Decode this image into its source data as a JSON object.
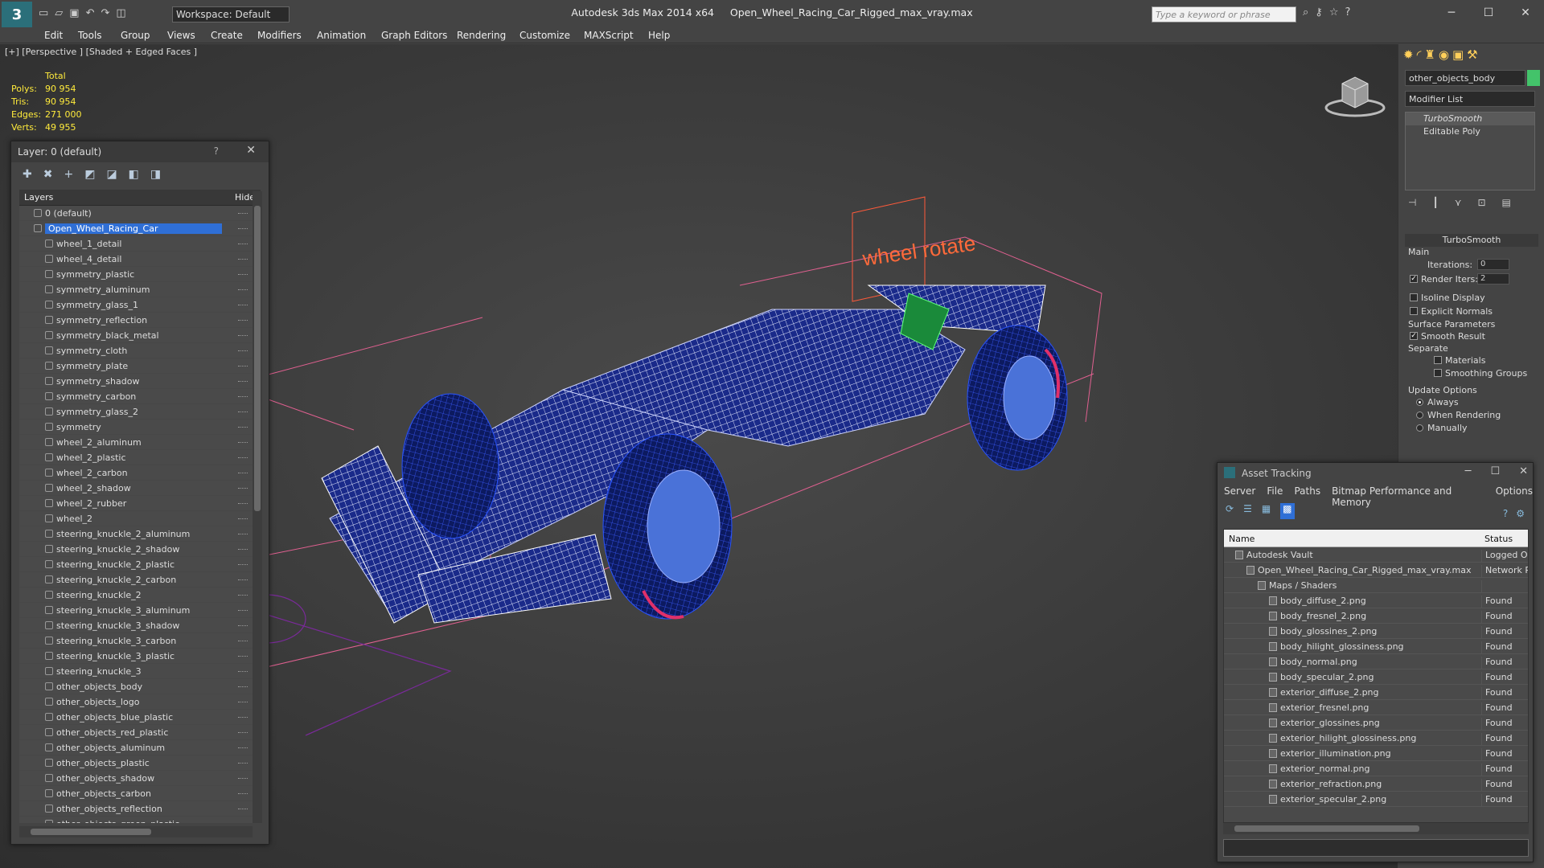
{
  "titlebar": {
    "workspace": "Workspace: Default",
    "app": "Autodesk 3ds Max  2014 x64",
    "file": "Open_Wheel_Racing_Car_Rigged_max_vray.max",
    "search_placeholder": "Type a keyword or phrase"
  },
  "menu": [
    "Edit",
    "Tools",
    "Group",
    "Views",
    "Create",
    "Modifiers",
    "Animation",
    "Graph Editors",
    "Rendering",
    "Customize",
    "MAXScript",
    "Help"
  ],
  "viewport": {
    "label": "[+] [Perspective ] [Shaded + Edged Faces ]",
    "stats_header": "Total",
    "stats": [
      {
        "k": "Polys:",
        "v": "90 954"
      },
      {
        "k": "Tris:",
        "v": "90 954"
      },
      {
        "k": "Edges:",
        "v": "271 000"
      },
      {
        "k": "Verts:",
        "v": "49 955"
      }
    ],
    "annotation": "wheel rotate"
  },
  "layers": {
    "title": "Layer: 0 (default)",
    "help": "?",
    "col_layers": "Layers",
    "col_hide": "Hide",
    "rows": [
      "0 (default)",
      "Open_Wheel_Racing_Car",
      "wheel_1_detail",
      "wheel_4_detail",
      "symmetry_plastic",
      "symmetry_aluminum",
      "symmetry_glass_1",
      "symmetry_reflection",
      "symmetry_black_metal",
      "symmetry_cloth",
      "symmetry_plate",
      "symmetry_shadow",
      "symmetry_carbon",
      "symmetry_glass_2",
      "symmetry",
      "wheel_2_aluminum",
      "wheel_2_plastic",
      "wheel_2_carbon",
      "wheel_2_shadow",
      "wheel_2_rubber",
      "wheel_2",
      "steering_knuckle_2_aluminum",
      "steering_knuckle_2_shadow",
      "steering_knuckle_2_plastic",
      "steering_knuckle_2_carbon",
      "steering_knuckle_2",
      "steering_knuckle_3_aluminum",
      "steering_knuckle_3_shadow",
      "steering_knuckle_3_carbon",
      "steering_knuckle_3_plastic",
      "steering_knuckle_3",
      "other_objects_body",
      "other_objects_logo",
      "other_objects_blue_plastic",
      "other_objects_red_plastic",
      "other_objects_aluminum",
      "other_objects_plastic",
      "other_objects_shadow",
      "other_objects_carbon",
      "other_objects_reflection",
      "other_objects_green_plastic"
    ]
  },
  "cmd": {
    "object_name": "other_objects_body",
    "object_color": "#43c36a",
    "modifier_list": "Modifier List",
    "stack": [
      "TurboSmooth",
      "Editable Poly"
    ],
    "rollout": "TurboSmooth",
    "main": "Main",
    "iterations_label": "Iterations:",
    "iterations": "0",
    "render_iters_label": "Render Iters:",
    "render_iters": "2",
    "isoline": "Isoline Display",
    "explicit": "Explicit Normals",
    "surface": "Surface Parameters",
    "smooth": "Smooth Result",
    "separate": "Separate",
    "materials": "Materials",
    "smoothing": "Smoothing Groups",
    "update": "Update Options",
    "always": "Always",
    "when": "When Rendering",
    "manually": "Manually"
  },
  "assets": {
    "title": "Asset Tracking",
    "menu": [
      "Server",
      "File",
      "Paths",
      "Bitmap Performance and Memory",
      "Options"
    ],
    "col_name": "Name",
    "col_status": "Status",
    "rows": [
      {
        "name": "Autodesk Vault",
        "status": "Logged Ou",
        "lvl": 0
      },
      {
        "name": "Open_Wheel_Racing_Car_Rigged_max_vray.max",
        "status": "Network P",
        "lvl": 1
      },
      {
        "name": "Maps / Shaders",
        "status": "",
        "lvl": 2
      },
      {
        "name": "body_diffuse_2.png",
        "status": "Found",
        "lvl": 3
      },
      {
        "name": "body_fresnel_2.png",
        "status": "Found",
        "lvl": 3
      },
      {
        "name": "body_glossines_2.png",
        "status": "Found",
        "lvl": 3
      },
      {
        "name": "body_hilight_glossiness.png",
        "status": "Found",
        "lvl": 3
      },
      {
        "name": "body_normal.png",
        "status": "Found",
        "lvl": 3
      },
      {
        "name": "body_specular_2.png",
        "status": "Found",
        "lvl": 3
      },
      {
        "name": "exterior_diffuse_2.png",
        "status": "Found",
        "lvl": 3
      },
      {
        "name": "exterior_fresnel.png",
        "status": "Found",
        "lvl": 3
      },
      {
        "name": "exterior_glossines.png",
        "status": "Found",
        "lvl": 3
      },
      {
        "name": "exterior_hilight_glossiness.png",
        "status": "Found",
        "lvl": 3
      },
      {
        "name": "exterior_illumination.png",
        "status": "Found",
        "lvl": 3
      },
      {
        "name": "exterior_normal.png",
        "status": "Found",
        "lvl": 3
      },
      {
        "name": "exterior_refraction.png",
        "status": "Found",
        "lvl": 3
      },
      {
        "name": "exterior_specular_2.png",
        "status": "Found",
        "lvl": 3
      }
    ]
  }
}
